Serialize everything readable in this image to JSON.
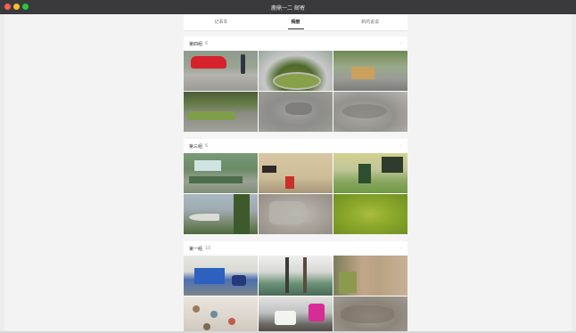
{
  "window": {
    "title": "鹿鼎一二 邮寄",
    "controls": {
      "close_color": "#ff5f57",
      "minimize_color": "#febc2e",
      "zoom_color": "#28c840"
    }
  },
  "tabs": [
    {
      "label": "记事本",
      "active": false
    },
    {
      "label": "相册",
      "active": true
    },
    {
      "label": "新的说说",
      "active": false
    }
  ],
  "groups": [
    {
      "title": "第四组",
      "count": "6",
      "photos": [
        "photo-red-car-sidewalk",
        "photo-fountain-garden",
        "photo-path-with-stall",
        "photo-road-with-greenery",
        "photo-paving-stones",
        "photo-crushed-gravel"
      ]
    },
    {
      "title": "第三组",
      "count": "6",
      "photos": [
        "photo-building-bins",
        "photo-beige-wall-red-box",
        "photo-yellow-building-door",
        "photo-jet-fighter-lawn",
        "photo-white-shoes-gravel",
        "photo-green-ground-cover"
      ]
    },
    {
      "title": "第一组",
      "count": "10",
      "photos": [
        "photo-blue-crates",
        "photo-mops-in-bucket",
        "photo-stone-tiles",
        "photo-drawings-on-wall",
        "photo-trash-items",
        "photo-rubble-pile"
      ]
    }
  ],
  "icons": {
    "chevron": "›"
  }
}
